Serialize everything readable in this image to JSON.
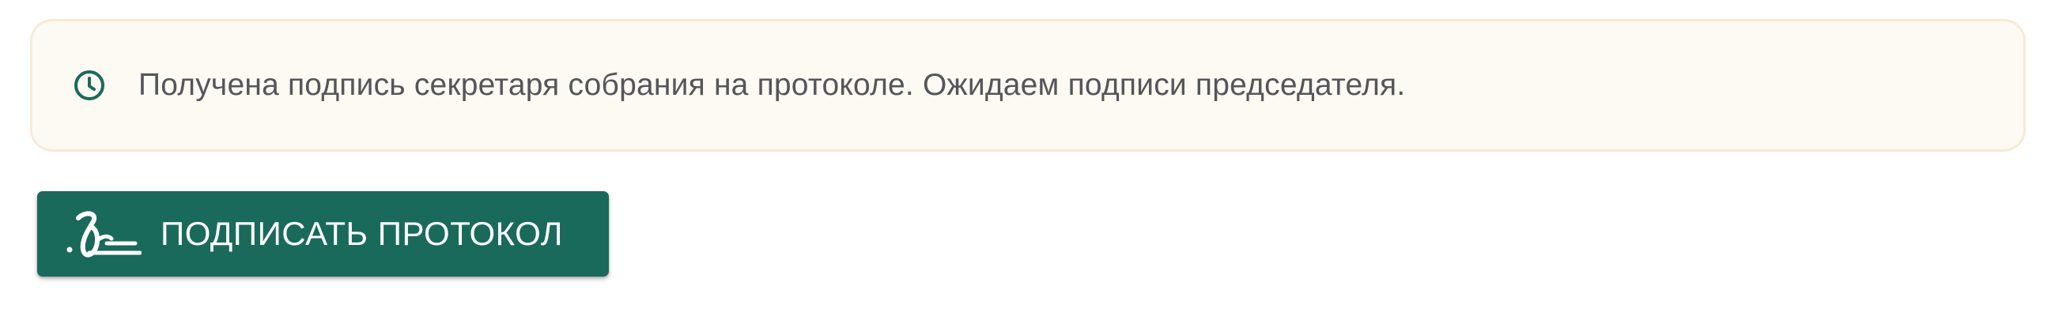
{
  "notice": {
    "icon": "clock-icon",
    "text": "Получена подпись секретаря собрания на протоколе. Ожидаем подписи председателя.",
    "background_color": "#fdf9f3",
    "border_color": "#f7ead7",
    "text_color": "#55565a"
  },
  "actions": {
    "sign_button_label": "ПОДПИСАТЬ ПРОТОКОЛ",
    "sign_button_icon": "signature-icon",
    "accent_color": "#1a6a5b"
  }
}
